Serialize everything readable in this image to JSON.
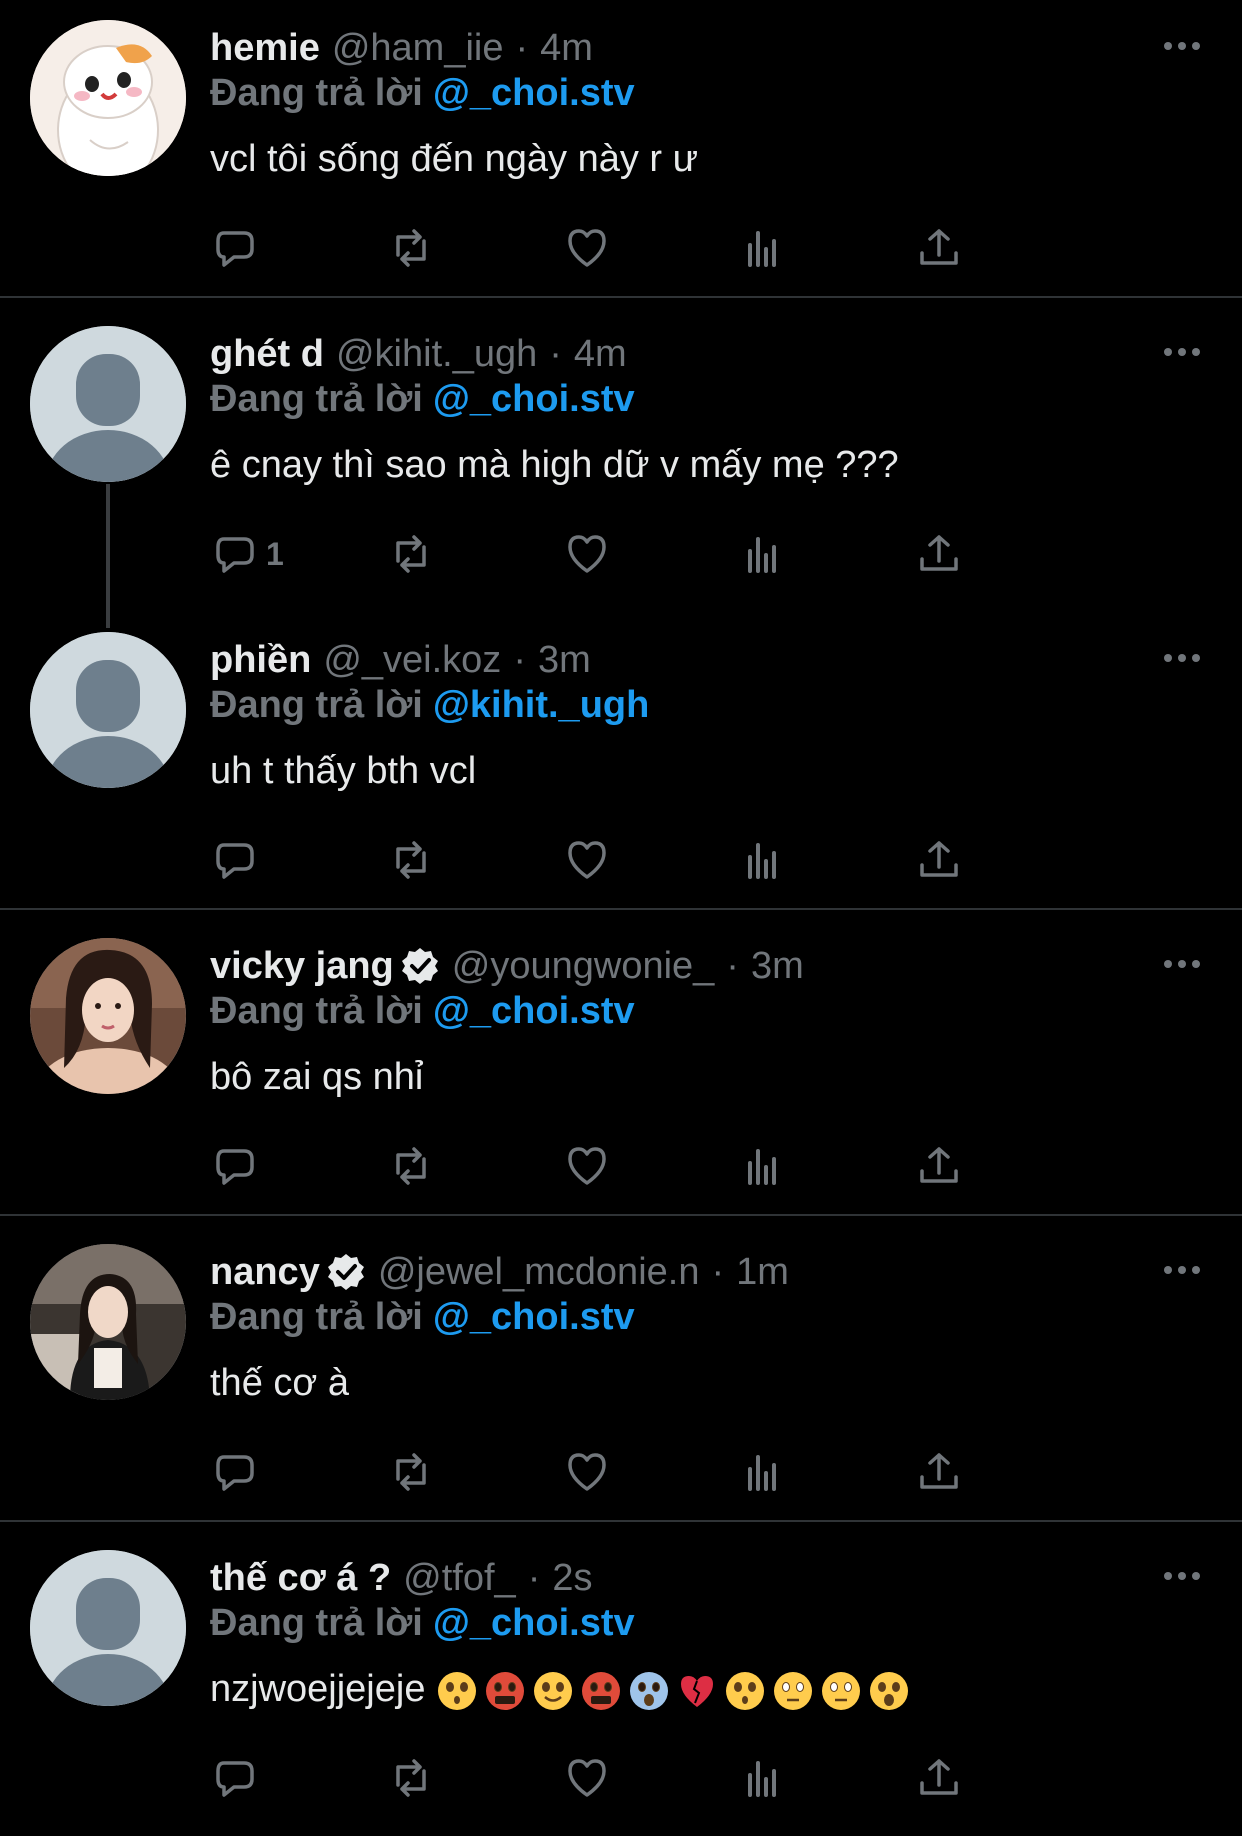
{
  "tweets": [
    {
      "name": "hemie",
      "handle": "@ham_iie",
      "separator": "·",
      "time": "4m",
      "replying_label": "Đang trả lời",
      "replying_to": "@_choi.stv",
      "text": "vcl tôi sống đến ngày này r ư",
      "verified": false,
      "avatar": "hamster-cartoon",
      "reply_count": ""
    },
    {
      "name": "ghét d",
      "handle": "@kihit._ugh",
      "separator": "·",
      "time": "4m",
      "replying_label": "Đang trả lời",
      "replying_to": "@_choi.stv",
      "text": "ê cnay thì sao mà high dữ v mấy mẹ ???",
      "verified": false,
      "avatar": "default",
      "reply_count": "1"
    },
    {
      "name": "phiền",
      "handle": "@_vei.koz",
      "separator": "·",
      "time": "3m",
      "replying_label": "Đang trả lời",
      "replying_to": "@kihit._ugh",
      "text": "uh t thấy bth vcl",
      "verified": false,
      "avatar": "default",
      "reply_count": ""
    },
    {
      "name": "vicky jang",
      "handle": "@youngwonie_",
      "separator": "·",
      "time": "3m",
      "replying_label": "Đang trả lời",
      "replying_to": "@_choi.stv",
      "text": "bô zai qs nhỉ",
      "verified": true,
      "avatar": "photo",
      "reply_count": ""
    },
    {
      "name": "nancy",
      "handle": "@jewel_mcdonie.n",
      "separator": "·",
      "time": "1m",
      "replying_label": "Đang trả lời",
      "replying_to": "@_choi.stv",
      "text": "thế cơ à",
      "verified": true,
      "avatar": "photo",
      "reply_count": ""
    },
    {
      "name": "thế cơ á ?",
      "handle": "@tfof_",
      "separator": "·",
      "time": "2s",
      "replying_label": "Đang trả lời",
      "replying_to": "@_choi.stv",
      "text": "nzjwoejjejeje",
      "verified": false,
      "avatar": "default",
      "reply_count": "",
      "emojis": [
        "pleading-face",
        "cursing-face",
        "smiling-face-with-hearts",
        "cursing-face",
        "screaming-face",
        "broken-heart",
        "hushed-face",
        "flushed-face",
        "flushed-face",
        "tired-face"
      ]
    }
  ],
  "colors": {
    "accent": "#1d9bf0",
    "muted": "#71767b",
    "text": "#e7e9ea",
    "divider": "#2f3336"
  },
  "icons": [
    "reply-icon",
    "retweet-icon",
    "like-icon",
    "views-icon",
    "share-icon",
    "more-icon",
    "verified-icon"
  ]
}
